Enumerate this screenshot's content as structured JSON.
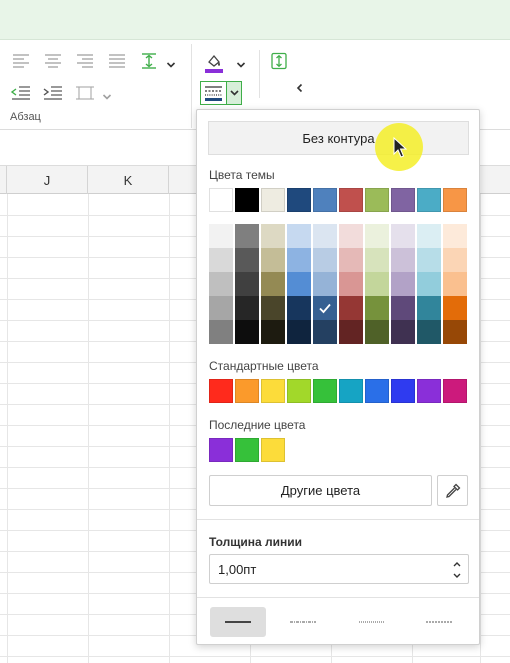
{
  "ribbon": {
    "group_label": "Абзац"
  },
  "sheet": {
    "columns": [
      "J",
      "K"
    ]
  },
  "popup": {
    "no_border_label": "Без контура",
    "theme_colors_label": "Цвета темы",
    "standard_colors_label": "Стандартные цвета",
    "recent_colors_label": "Последние цвета",
    "more_colors_label": "Другие цвета",
    "line_width_label": "Толщина линии",
    "line_width_value": "1,00пт",
    "theme_colors": [
      "#ffffff",
      "#000000",
      "#eeece1",
      "#1f497d",
      "#4f81bd",
      "#c0504d",
      "#9bbb59",
      "#8064a2",
      "#4bacc6",
      "#f79646"
    ],
    "theme_shades": [
      [
        "#f2f2f2",
        "#d9d9d9",
        "#bfbfbf",
        "#a6a6a6",
        "#808080"
      ],
      [
        "#7f7f7f",
        "#595959",
        "#404040",
        "#262626",
        "#0d0d0d"
      ],
      [
        "#ddd9c3",
        "#c4bd97",
        "#948a54",
        "#4a452a",
        "#1d1b10"
      ],
      [
        "#c6d9f0",
        "#8db3e2",
        "#548dd4",
        "#17365d",
        "#0f243e"
      ],
      [
        "#dbe5f1",
        "#b8cce4",
        "#95b3d7",
        "#366092",
        "#244061"
      ],
      [
        "#f2dcdb",
        "#e5b9b7",
        "#d99694",
        "#953734",
        "#632423"
      ],
      [
        "#ebf1dd",
        "#d7e3bc",
        "#c3d69b",
        "#76923c",
        "#4f6128"
      ],
      [
        "#e5e0ec",
        "#ccc1d9",
        "#b2a2c7",
        "#5f497a",
        "#3f3151"
      ],
      [
        "#dbeef3",
        "#b7dde8",
        "#92cddc",
        "#31859b",
        "#205867"
      ],
      [
        "#fdeada",
        "#fbd5b5",
        "#fac08f",
        "#e36c09",
        "#974806"
      ]
    ],
    "selected_shade": {
      "column": 4,
      "row": 3
    },
    "standard_colors": [
      "#ff2a1c",
      "#fb9a2b",
      "#fcdc3a",
      "#a2d82a",
      "#36c13a",
      "#16a4c4",
      "#2a6fe8",
      "#2f3bf0",
      "#8a2fd9",
      "#cc1a7c"
    ],
    "recent_colors": [
      "#8a2fd9",
      "#36c13a",
      "#fcdc3a"
    ]
  },
  "colors": {
    "accent_green": "#3fae49",
    "ribbon_top": "#e8f5e8"
  }
}
